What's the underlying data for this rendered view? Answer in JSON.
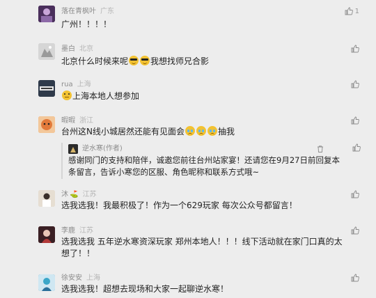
{
  "comments": [
    {
      "name": "落在青枫叶",
      "location": "广东",
      "text": "广州！！！！",
      "like_count": "1",
      "avatar_color": "#6b4a7a"
    },
    {
      "name": "墨白",
      "location": "北京",
      "text_before": "北京什么时候来呢",
      "emojis": [
        "sunglasses-emoji",
        "sunglasses-emoji"
      ],
      "text_after": "我想找师兄合影",
      "like_count": "",
      "avatar_color": "#c9c9c9"
    },
    {
      "name": "rua",
      "location": "上海",
      "emoji_before": "expressionless-emoji",
      "text": "上海本地人想参加",
      "like_count": "",
      "avatar_color": "#3c4a5c"
    },
    {
      "name": "暇暇",
      "location": "浙江",
      "text_before": "台州这N线小城居然还能有见面会",
      "emojis": [
        "crying-emoji",
        "crying-emoji",
        "crying-emoji"
      ],
      "text_after": "抽我",
      "like_count": "",
      "avatar_color": "#e59a3a",
      "reply": {
        "name": "逆水寒(作者)",
        "text": "感谢同门的支持和陪伴，诚邀您前往台州站家宴！还请您在9月27日前回复本条留言，告诉小寒您的区服、角色昵称和联系方式哦~",
        "like_count": "",
        "avatar_color": "#2b2b2b"
      }
    },
    {
      "name": "沐",
      "badge": "⛳",
      "location": "江苏",
      "text": "选我选我！我最积极了！作为一个629玩家 每次公众号都留言！",
      "like_count": "",
      "avatar_color": "#d8d0c4"
    },
    {
      "name": "李鹿",
      "location": "江苏",
      "text": "选我选我 五年逆水寒资深玩家 郑州本地人！！！线下活动就在家门口真的太想了！！",
      "like_count": "",
      "avatar_color": "#7a2a2a"
    },
    {
      "name": "徐安安",
      "location": "上海",
      "text": "选我选我！超想去现场和大家一起聊逆水寒！",
      "like_count": "",
      "avatar_color": "#3a8fb8"
    }
  ],
  "colors": {
    "background": "#ededed",
    "name": "#8c8c8c",
    "location": "#b4b4b4",
    "text": "#222222",
    "emoji": "#f2c232"
  },
  "icons": {
    "like": "thumbs-up-icon",
    "delete": "trash-icon"
  }
}
